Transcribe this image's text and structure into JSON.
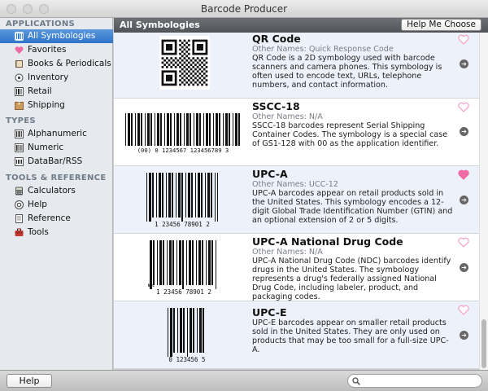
{
  "window": {
    "title": "Barcode Producer"
  },
  "sidebar": {
    "sections": [
      {
        "label": "APPLICATIONS",
        "items": [
          {
            "label": "All Symbologies",
            "icon": "all-symbologies-icon",
            "selected": true
          },
          {
            "label": "Favorites",
            "icon": "heart-icon"
          },
          {
            "label": "Books & Periodicals",
            "icon": "book-icon"
          },
          {
            "label": "Inventory",
            "icon": "inventory-icon"
          },
          {
            "label": "Retail",
            "icon": "retail-icon"
          },
          {
            "label": "Shipping",
            "icon": "shipping-box-icon"
          }
        ]
      },
      {
        "label": "TYPES",
        "items": [
          {
            "label": "Alphanumeric",
            "icon": "alphanumeric-icon"
          },
          {
            "label": "Numeric",
            "icon": "numeric-icon"
          },
          {
            "label": "DataBar/RSS",
            "icon": "databar-icon"
          }
        ]
      },
      {
        "label": "TOOLS & REFERENCE",
        "items": [
          {
            "label": "Calculators",
            "icon": "calculator-icon"
          },
          {
            "label": "Help",
            "icon": "help-icon"
          },
          {
            "label": "Reference",
            "icon": "reference-icon"
          },
          {
            "label": "Tools",
            "icon": "toolbox-icon"
          }
        ]
      }
    ]
  },
  "main": {
    "header_title": "All Symbologies",
    "help_me_choose_label": "Help Me Choose"
  },
  "symbologies": [
    {
      "name": "QR Code",
      "other_names": "Other Names: Quick Response Code",
      "description": "QR Code is a 2D symbology used with barcode scanners and camera phones. This symbology is often used to encode text, URLs, telephone numbers, and contact information.",
      "favorite": false,
      "barcode_text": ""
    },
    {
      "name": "SSCC-18",
      "other_names": "Other Names: N/A",
      "description": "SSCC-18 barcodes represent Serial Shipping Container Codes. The symbology is a special case of GS1-128 with 00 as the application identifier.",
      "favorite": false,
      "barcode_text": "(00) 0 1234567 123456789 3"
    },
    {
      "name": "UPC-A",
      "other_names": "Other Names: UCC-12",
      "description": "UPC-A barcodes appear on retail products sold in the United States. This symbology encodes a 12-digit Global Trade Identification Number (GTIN) and an optional extension of 2 or 5 digits.",
      "favorite": true,
      "barcode_text": "1 23456 78901 2"
    },
    {
      "name": "UPC-A National Drug Code",
      "other_names": "Other Names: N/A",
      "description": "UPC-A National Drug Code (NDC) barcodes identify drugs in the United States. The symbology represents a drug's federally assigned National Drug Code, including labeler, product, and packaging codes.",
      "favorite": false,
      "barcode_text": "1 23456 78901 2",
      "barcode_side_text": "NDC"
    },
    {
      "name": "UPC-E",
      "other_names": "",
      "description": "UPC-E barcodes appear on smaller retail products sold in the United States. They are only used on products that may be too small for a full-size UPC-A.",
      "favorite": false,
      "barcode_text": "0 123456 5"
    }
  ],
  "bottombar": {
    "help_label": "Help",
    "search_placeholder": ""
  },
  "colors": {
    "selection": "#3b7fd0",
    "heart_on": "#f06aa6",
    "heart_off": "#f3a6c8",
    "header": "#5e6267"
  }
}
